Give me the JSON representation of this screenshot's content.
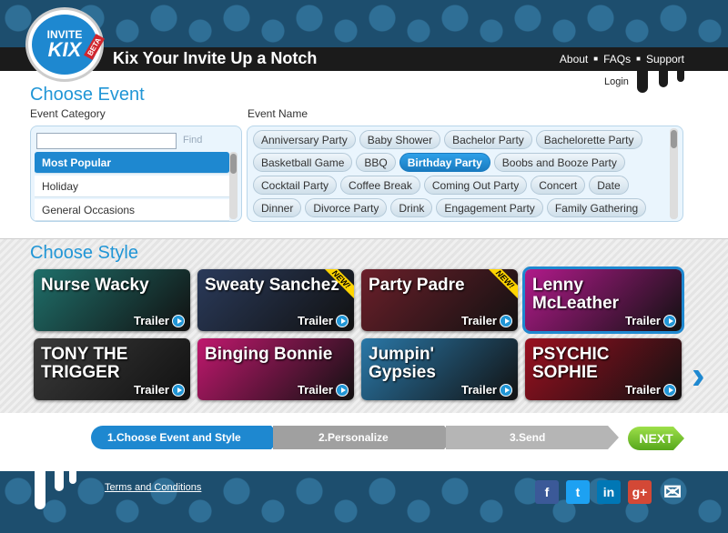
{
  "header": {
    "logo_line1": "INVITE",
    "logo_line2": "KIX",
    "beta": "BETA",
    "tagline": "Kix Your Invite Up a Notch",
    "nav": [
      "About",
      "FAQs",
      "Support"
    ],
    "login": "Login"
  },
  "choose_event": {
    "title": "Choose Event",
    "category_label": "Event Category",
    "name_label": "Event Name",
    "search_value": "",
    "find_label": "Find",
    "categories": [
      {
        "label": "Most Popular",
        "selected": true
      },
      {
        "label": "Holiday",
        "selected": false
      },
      {
        "label": "General Occasions",
        "selected": false
      }
    ],
    "event_names": [
      "Anniversary Party",
      "Baby Shower",
      "Bachelor Party",
      "Bachelorette Party",
      "Basketball Game",
      "BBQ",
      "Birthday Party",
      "Boobs and Booze Party",
      "Cocktail Party",
      "Coffee Break",
      "Coming Out Party",
      "Concert",
      "Date",
      "Dinner",
      "Divorce Party",
      "Drink",
      "Engagement Party",
      "Family Gathering"
    ],
    "selected_event": "Birthday Party"
  },
  "choose_style": {
    "title": "Choose Style",
    "trailer_label": "Trailer",
    "new_label": "NEW!",
    "styles": [
      {
        "name": "Nurse Wacky",
        "new": false,
        "color": "#1f6f6a"
      },
      {
        "name": "Sweaty Sanchez",
        "new": true,
        "color": "#2a3a5a"
      },
      {
        "name": "Party Padre",
        "new": true,
        "color": "#6b1f2a"
      },
      {
        "name": "Lenny McLeather",
        "new": false,
        "color": "#b01a8a",
        "selected": true
      },
      {
        "name": "TONY THE TRIGGER",
        "new": false,
        "color": "#3a3a3a"
      },
      {
        "name": "Binging Bonnie",
        "new": false,
        "color": "#c0186e"
      },
      {
        "name": "Jumpin' Gypsies",
        "new": false,
        "color": "#2a78a8"
      },
      {
        "name": "PSYCHIC SOPHIE",
        "new": false,
        "color": "#9a1020"
      }
    ],
    "next_arrow": "›"
  },
  "steps": {
    "step1": "1.Choose Event and Style",
    "step2": "2.Personalize",
    "step3": "3.Send",
    "next": "NEXT"
  },
  "footer": {
    "terms": "Terms and Conditions",
    "social": [
      {
        "icon": "facebook-icon",
        "glyph": "f",
        "color": "#3b5998"
      },
      {
        "icon": "twitter-icon",
        "glyph": "t",
        "color": "#1da1f2"
      },
      {
        "icon": "linkedin-icon",
        "glyph": "in",
        "color": "#0077b5"
      },
      {
        "icon": "googleplus-icon",
        "glyph": "g+",
        "color": "#d34836"
      },
      {
        "icon": "email-icon",
        "glyph": "✉",
        "color": "#dddddd"
      }
    ]
  }
}
